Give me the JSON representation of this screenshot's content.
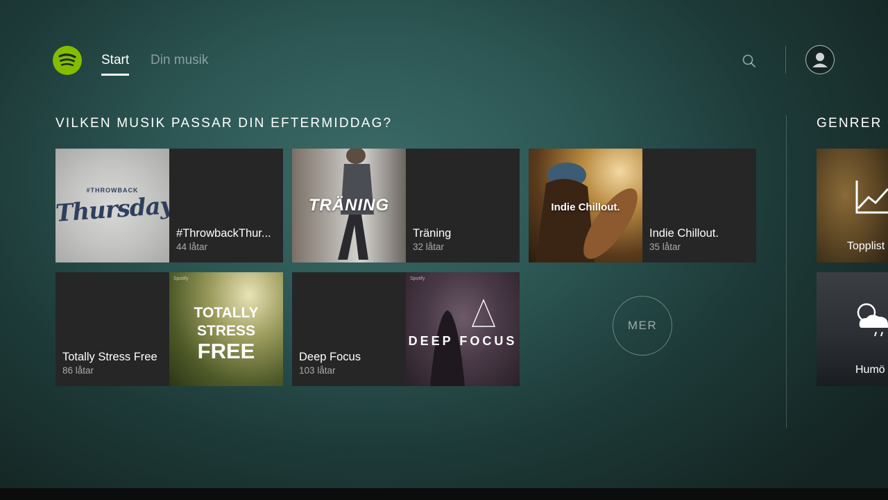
{
  "header": {
    "tabs": [
      {
        "label": "Start",
        "active": true
      },
      {
        "label": "Din musik",
        "active": false
      }
    ]
  },
  "section": {
    "title": "VILKEN MUSIK PASSAR DIN EFTERMIDDAG?",
    "more_label": "MER"
  },
  "playlists": [
    {
      "name": "#ThrowbackThur...",
      "count": "44 låtar",
      "art_text": "Thursday",
      "art_subtext": "#THROWBACK"
    },
    {
      "name": "Träning",
      "count": "32 låtar",
      "art_text": "TRÄNING"
    },
    {
      "name": "Indie Chillout.",
      "count": "35 låtar",
      "art_text": "Indie Chillout."
    },
    {
      "name": "Totally Stress Free",
      "count": "86 låtar",
      "art_badge": "Spotify",
      "art_line1": "TOTALLY",
      "art_line2": "STRESS",
      "art_line3": "FREE"
    },
    {
      "name": "Deep Focus",
      "count": "103 låtar",
      "art_badge": "Spotify",
      "art_text": "DEEP FOCUS"
    }
  ],
  "genres": {
    "title": "GENRER O",
    "items": [
      {
        "label": "Topplist"
      },
      {
        "label": "Humö"
      }
    ]
  },
  "colors": {
    "brand": "#84bd00",
    "card_bg": "#262626"
  }
}
